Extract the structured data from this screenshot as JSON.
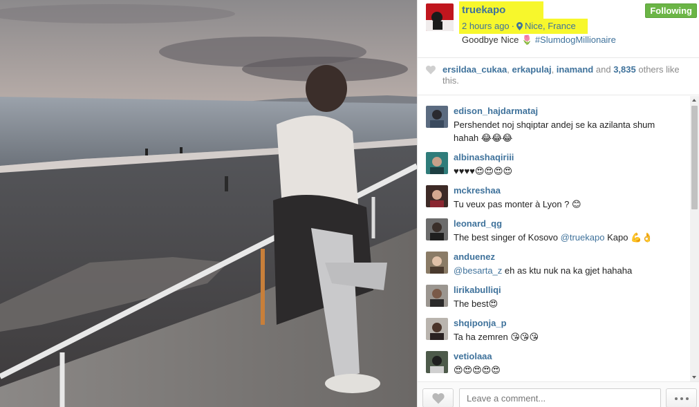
{
  "post": {
    "username": "truekapo",
    "time_ago": "2 hours ago",
    "separator": "·",
    "location": "Nice, France",
    "caption_text": "Goodbye Nice 🌷",
    "caption_hashtag": "#SlumdogMillionaire",
    "follow_label": "Following"
  },
  "likes": {
    "user1": "ersildaa_cukaa",
    "user2": "erkapulaj",
    "user3": "inamand",
    "connector1": ", ",
    "connector2": ", ",
    "and_text": " and ",
    "count": "3,835",
    "suffix": " others like this."
  },
  "comments": [
    {
      "user": "edison_hajdarmataj",
      "text": "Pershendet noj shqiptar andej se ka azilanta shum hahah 😂😂😂"
    },
    {
      "user": "albinashaqiriii",
      "text": "♥♥♥♥😍😍😍😍"
    },
    {
      "user": "mckreshaa",
      "text": "Tu veux pas monter à Lyon ? 😊"
    },
    {
      "user": "leonard_qg",
      "text_pre": "The best singer of Kosovo ",
      "mention": "@truekapo",
      "text_post": " Kapo 💪👌"
    },
    {
      "user": "anduenez",
      "mention": "@besarta_z",
      "text_post": " eh as ktu nuk na ka gjet hahaha"
    },
    {
      "user": "lirikabulliqi",
      "text": "The best😍"
    },
    {
      "user": "shqiponja_p",
      "text": "Ta ha zemren 😘😘😘"
    },
    {
      "user": "vetiolaaa",
      "text": "😍😍😍😍😍"
    }
  ],
  "footer": {
    "comment_placeholder": "Leave a comment..."
  },
  "icons": {
    "location": "map-pin-icon",
    "like": "heart-icon",
    "more": "ellipsis-icon"
  },
  "colors": {
    "link": "#3f729b",
    "follow_green": "#6bb546",
    "highlight": "#f7f72c"
  }
}
